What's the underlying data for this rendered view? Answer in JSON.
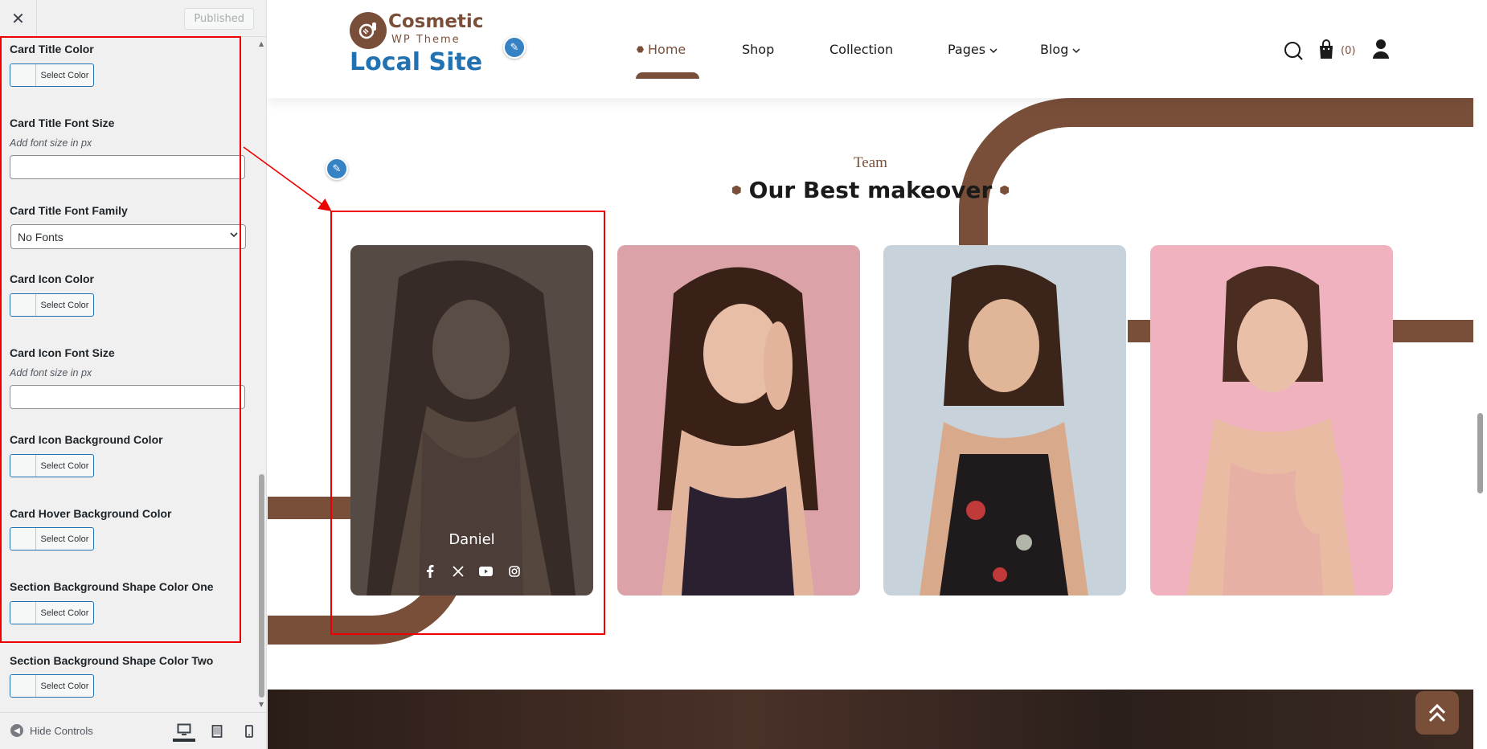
{
  "customizer": {
    "close_label": "✕",
    "publish_button": "Published",
    "controls": [
      {
        "label": "Card Title Color",
        "type": "color",
        "button": "Select Color"
      },
      {
        "label": "Card Title Font Size",
        "type": "text",
        "description": "Add font size in px",
        "value": ""
      },
      {
        "label": "Card Title Font Family",
        "type": "select",
        "value": "No Fonts"
      },
      {
        "label": "Card Icon Color",
        "type": "color",
        "button": "Select Color"
      },
      {
        "label": "Card Icon Font Size",
        "type": "text",
        "description": "Add font size in px",
        "value": ""
      },
      {
        "label": "Card Icon Background Color",
        "type": "color",
        "button": "Select Color"
      },
      {
        "label": "Card Hover Background Color",
        "type": "color",
        "button": "Select Color"
      },
      {
        "label": "Section Background Shape Color One",
        "type": "color",
        "button": "Select Color"
      },
      {
        "label": "Section Background Shape Color Two",
        "type": "color",
        "button": "Select Color"
      }
    ],
    "footer": {
      "hide_controls": "Hide Controls",
      "devices": [
        "desktop-icon",
        "tablet-icon",
        "mobile-icon"
      ],
      "active_device": "desktop"
    }
  },
  "site": {
    "logo_name": "Cosmetic",
    "logo_sub": "WP Theme",
    "site_title": "Local Site",
    "nav": [
      {
        "label": "Home",
        "active": true
      },
      {
        "label": "Shop"
      },
      {
        "label": "Collection"
      },
      {
        "label": "Pages",
        "dropdown": true
      },
      {
        "label": "Blog",
        "dropdown": true
      }
    ],
    "cart_count": "(0)",
    "icons": [
      "search-icon",
      "cart-icon",
      "user-icon"
    ]
  },
  "section": {
    "tag": "Team",
    "title": "Our Best makeover",
    "cards": [
      {
        "name": "Daniel",
        "hovered": true,
        "background": "#3a3a3a"
      },
      {
        "name": "",
        "background": "#dba3a7"
      },
      {
        "name": "",
        "background": "#c7d2da"
      },
      {
        "name": "",
        "background": "#f0b2bf"
      }
    ],
    "socials": [
      "facebook-icon",
      "x-icon",
      "youtube-icon",
      "instagram-icon"
    ]
  },
  "colors": {
    "brand": "#7a4f3a",
    "accent_blue": "#2271b1",
    "highlight": "#ee0000"
  }
}
